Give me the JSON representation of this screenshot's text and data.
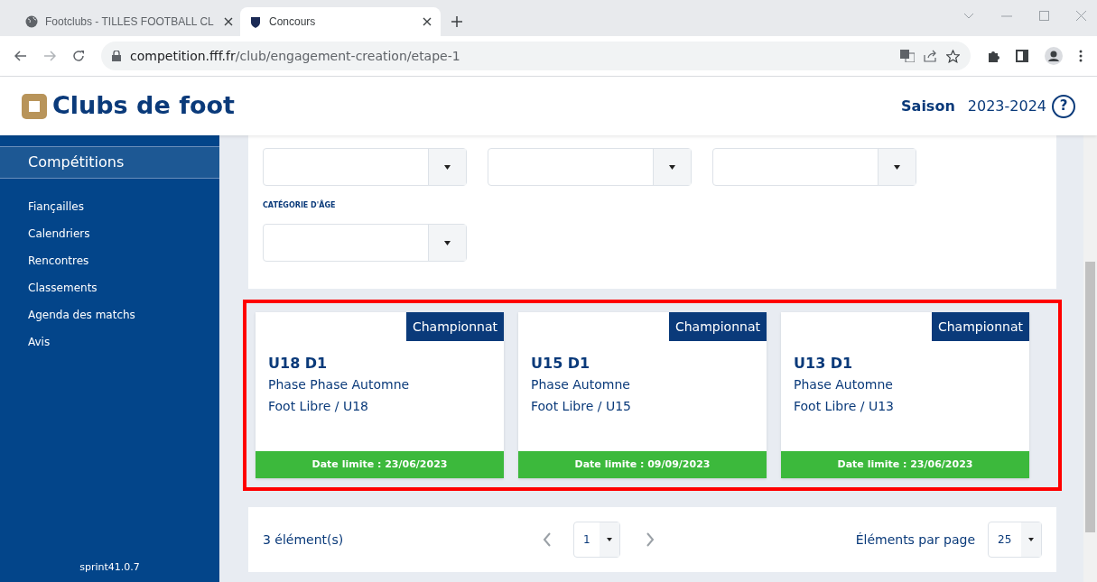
{
  "browser": {
    "tabs": [
      {
        "title": "Footclubs - TILLES FOOTBALL CL",
        "selected": false
      },
      {
        "title": "Concours",
        "selected": true
      }
    ],
    "address": {
      "host": "competition.fff.fr",
      "path": "/club/engagement-creation/etape-1"
    }
  },
  "header": {
    "logo": "Clubs de foot",
    "season_label": "Saison",
    "season": "2023-2024",
    "help": "?"
  },
  "sidebar": {
    "section": "Compétitions",
    "items": [
      {
        "label": "Fiançailles"
      },
      {
        "label": "Calendriers"
      },
      {
        "label": "Rencontres"
      },
      {
        "label": "Classements"
      },
      {
        "label": "Agenda des matchs"
      },
      {
        "label": "Avis"
      }
    ],
    "version": "sprint41.0.7"
  },
  "filters": {
    "row_1": [
      {
        "kind": "select"
      },
      {
        "kind": "select"
      },
      {
        "kind": "select"
      }
    ],
    "age_label": "CATÉGORIE D'ÂGE",
    "row_2": [
      {
        "kind": "select"
      }
    ]
  },
  "cards_section": {
    "highlighted": true,
    "cards": [
      {
        "badge": "Championnat",
        "title": "U18 D1",
        "phase": "Phase Phase Automne",
        "category": "Foot Libre / U18",
        "deadline": "Date limite : 23/06/2023"
      },
      {
        "badge": "Championnat",
        "title": "U15 D1",
        "phase": "Phase Automne",
        "category": "Foot Libre / U15",
        "deadline": "Date limite : 09/09/2023"
      },
      {
        "badge": "Championnat",
        "title": "U13 D1",
        "phase": "Phase Automne",
        "category": "Foot Libre / U13",
        "deadline": "Date limite : 23/06/2023"
      }
    ]
  },
  "pagination": {
    "count": "3 élément(s)",
    "page": "1",
    "per_page_label": "Éléments par page",
    "per_page": "25"
  }
}
